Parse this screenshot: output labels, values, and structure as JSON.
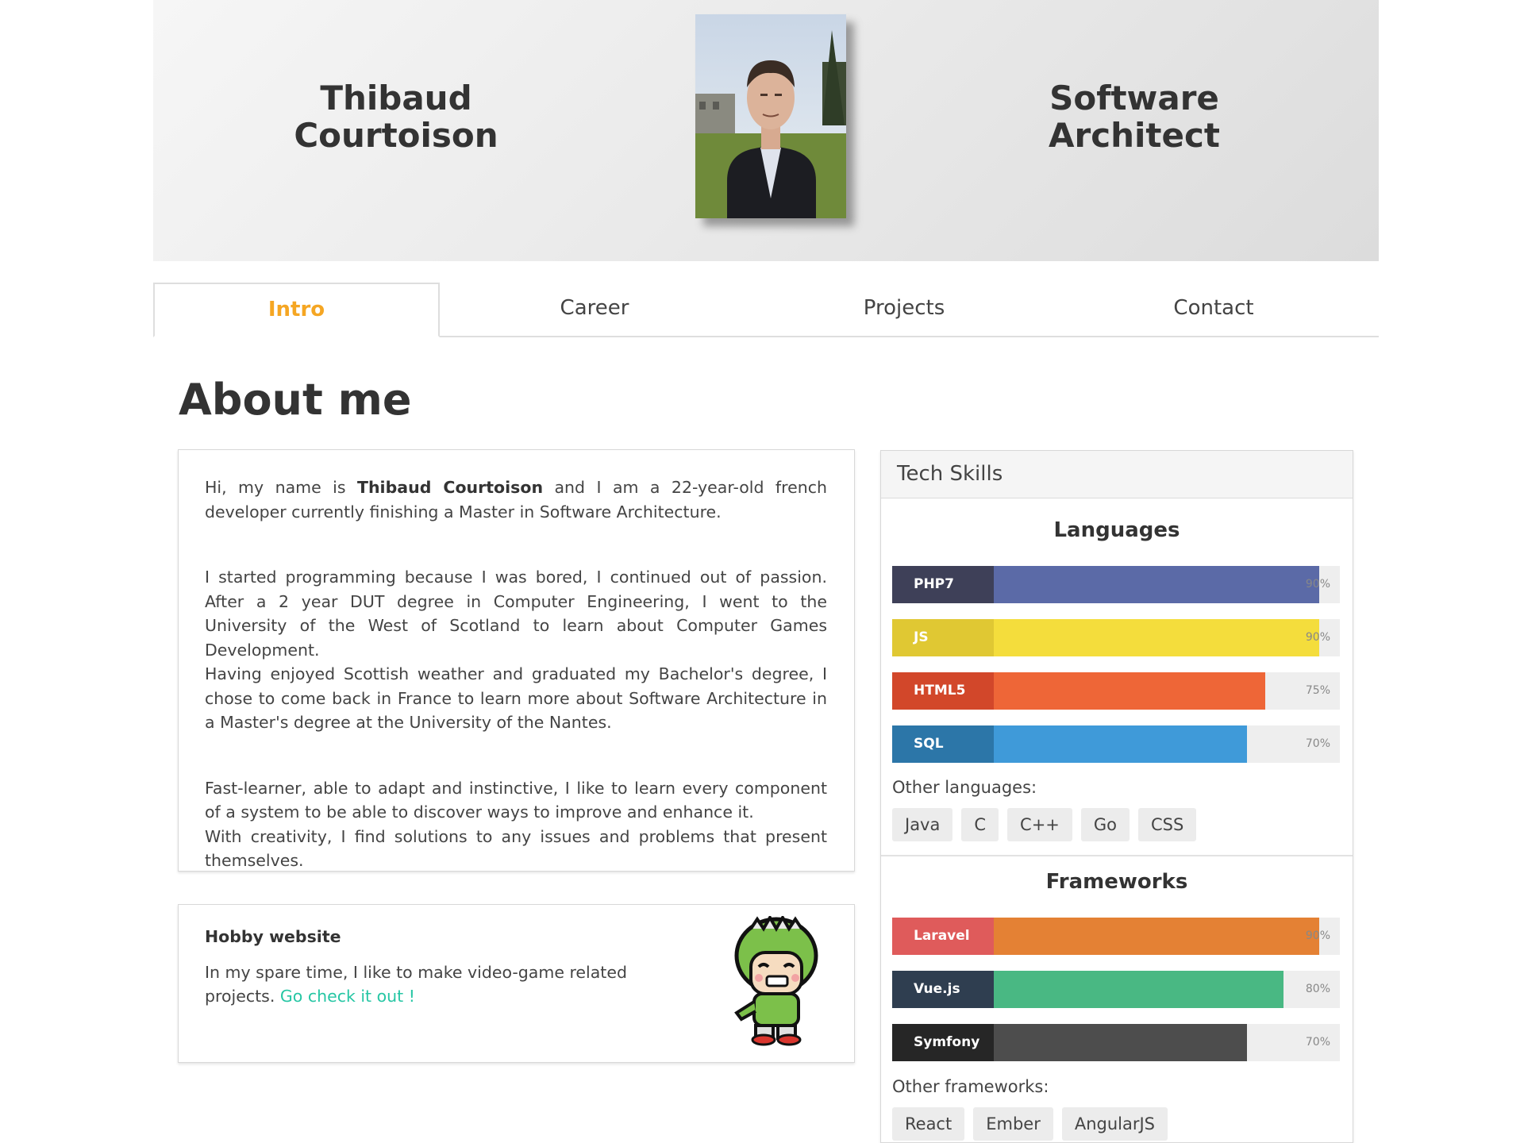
{
  "header": {
    "name_line1": "Thibaud",
    "name_line2": "Courtoison",
    "role_line1": "Software",
    "role_line2": "Architect"
  },
  "tabs": [
    {
      "label": "Intro",
      "active": true
    },
    {
      "label": "Career",
      "active": false
    },
    {
      "label": "Projects",
      "active": false
    },
    {
      "label": "Contact",
      "active": false
    }
  ],
  "about": {
    "title": "About me",
    "p1_pre": "Hi, my name is ",
    "p1_bold": "Thibaud Courtoison",
    "p1_post": " and I am a 22-year-old french developer currently finishing a Master in Software Architecture.",
    "p2a": "I started programming because I was bored, I continued out of passion. After a 2 year DUT degree in Computer Engineering, I went to the University of the West of Scotland to learn about Computer Games Development.",
    "p2b": "Having enjoyed Scottish weather and graduated my Bachelor's degree, I chose to come back in France to learn more about Software Architecture in a Master's degree at the University of the Nantes.",
    "p3a": "Fast-learner, able to adapt and instinctive, I like to learn every component of a system to be able to discover ways to improve and enhance it.",
    "p3b": "With creativity, I find solutions to any issues and problems that present themselves."
  },
  "hobby": {
    "title": "Hobby website",
    "text": "In my spare time, I like to make video-game related projects. ",
    "link": "Go check it out !"
  },
  "skills": {
    "panel_title": "Tech Skills",
    "languages_title": "Languages",
    "languages": [
      {
        "name": "PHP7",
        "value": 90,
        "pct": "90%",
        "label_color": "#3e4058",
        "fill_color": "#5b6aa7"
      },
      {
        "name": "JS",
        "value": 90,
        "pct": "90%",
        "label_color": "#e0c833",
        "fill_color": "#f4dd3c"
      },
      {
        "name": "HTML5",
        "value": 75,
        "pct": "75%",
        "label_color": "#d2472a",
        "fill_color": "#ee6637"
      },
      {
        "name": "SQL",
        "value": 70,
        "pct": "70%",
        "label_color": "#2c76a8",
        "fill_color": "#3f9ad9"
      }
    ],
    "other_languages_label": "Other languages:",
    "other_languages": [
      "Java",
      "C",
      "C++",
      "Go",
      "CSS"
    ],
    "frameworks_title": "Frameworks",
    "frameworks": [
      {
        "name": "Laravel",
        "value": 90,
        "pct": "90%",
        "label_color": "#df5b5b",
        "fill_color": "#e48134"
      },
      {
        "name": "Vue.js",
        "value": 80,
        "pct": "80%",
        "label_color": "#2f3e50",
        "fill_color": "#49b883"
      },
      {
        "name": "Symfony",
        "value": 70,
        "pct": "70%",
        "label_color": "#262626",
        "fill_color": "#4d4d4d"
      }
    ],
    "other_frameworks_label": "Other frameworks:",
    "other_frameworks": [
      "React",
      "Ember",
      "AngularJS"
    ]
  }
}
